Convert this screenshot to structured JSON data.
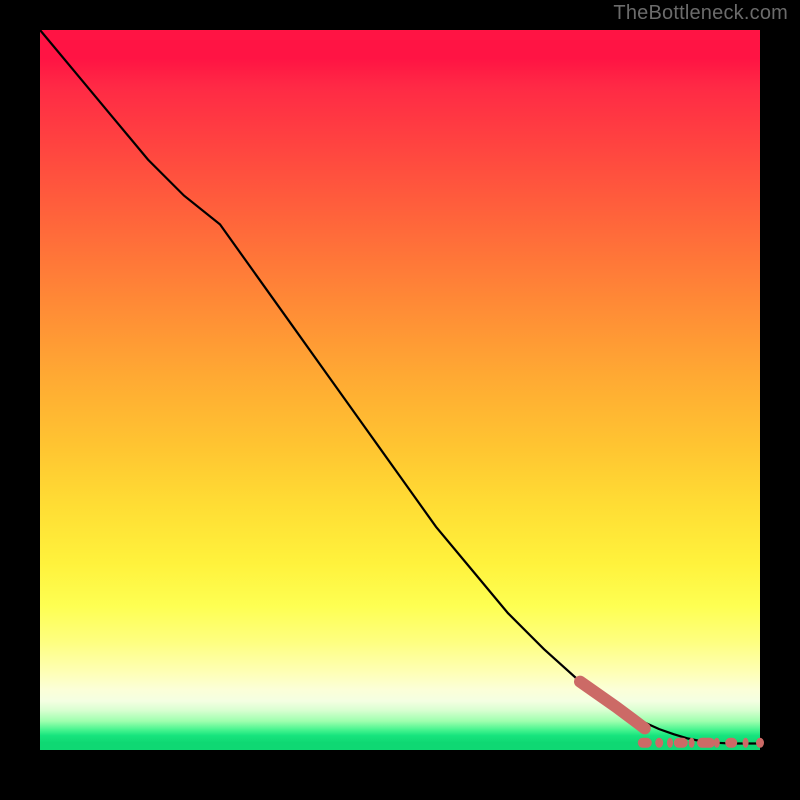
{
  "watermark": "TheBottleneck.com",
  "chart_data": {
    "type": "line",
    "title": "",
    "xlabel": "",
    "ylabel": "",
    "xlim": [
      0,
      100
    ],
    "ylim": [
      0,
      100
    ],
    "grid": false,
    "legend": false,
    "series": [
      {
        "name": "curve",
        "x": [
          0,
          5,
          10,
          15,
          20,
          25,
          30,
          35,
          40,
          45,
          50,
          55,
          60,
          65,
          70,
          75,
          80,
          82,
          84,
          86,
          88,
          90,
          92,
          94,
          96,
          98,
          100
        ],
        "y": [
          100,
          94,
          88,
          82,
          77,
          73,
          66,
          59,
          52,
          45,
          38,
          31,
          25,
          19,
          14,
          9.5,
          6.0,
          4.8,
          3.8,
          2.9,
          2.2,
          1.6,
          1.2,
          1.0,
          0.9,
          0.9,
          0.9
        ]
      },
      {
        "name": "thick-tail-segment",
        "x": [
          75,
          80,
          84
        ],
        "y": [
          9.5,
          6.0,
          3.0
        ]
      },
      {
        "name": "flat-tail-markers",
        "x": [
          84,
          86,
          87.5,
          89,
          90.5,
          92.5,
          94,
          96,
          98,
          100
        ],
        "y": [
          1.0,
          1.0,
          1.0,
          1.0,
          1.0,
          1.0,
          1.0,
          1.0,
          1.0,
          1.0
        ]
      }
    ],
    "background_gradient": {
      "stops": [
        {
          "pos": 0.0,
          "color": "#ff1444"
        },
        {
          "pos": 0.38,
          "color": "#ff8a36"
        },
        {
          "pos": 0.66,
          "color": "#ffdd34"
        },
        {
          "pos": 0.86,
          "color": "#feffa0"
        },
        {
          "pos": 0.97,
          "color": "#47f48f"
        },
        {
          "pos": 1.0,
          "color": "#0fd873"
        }
      ]
    }
  }
}
